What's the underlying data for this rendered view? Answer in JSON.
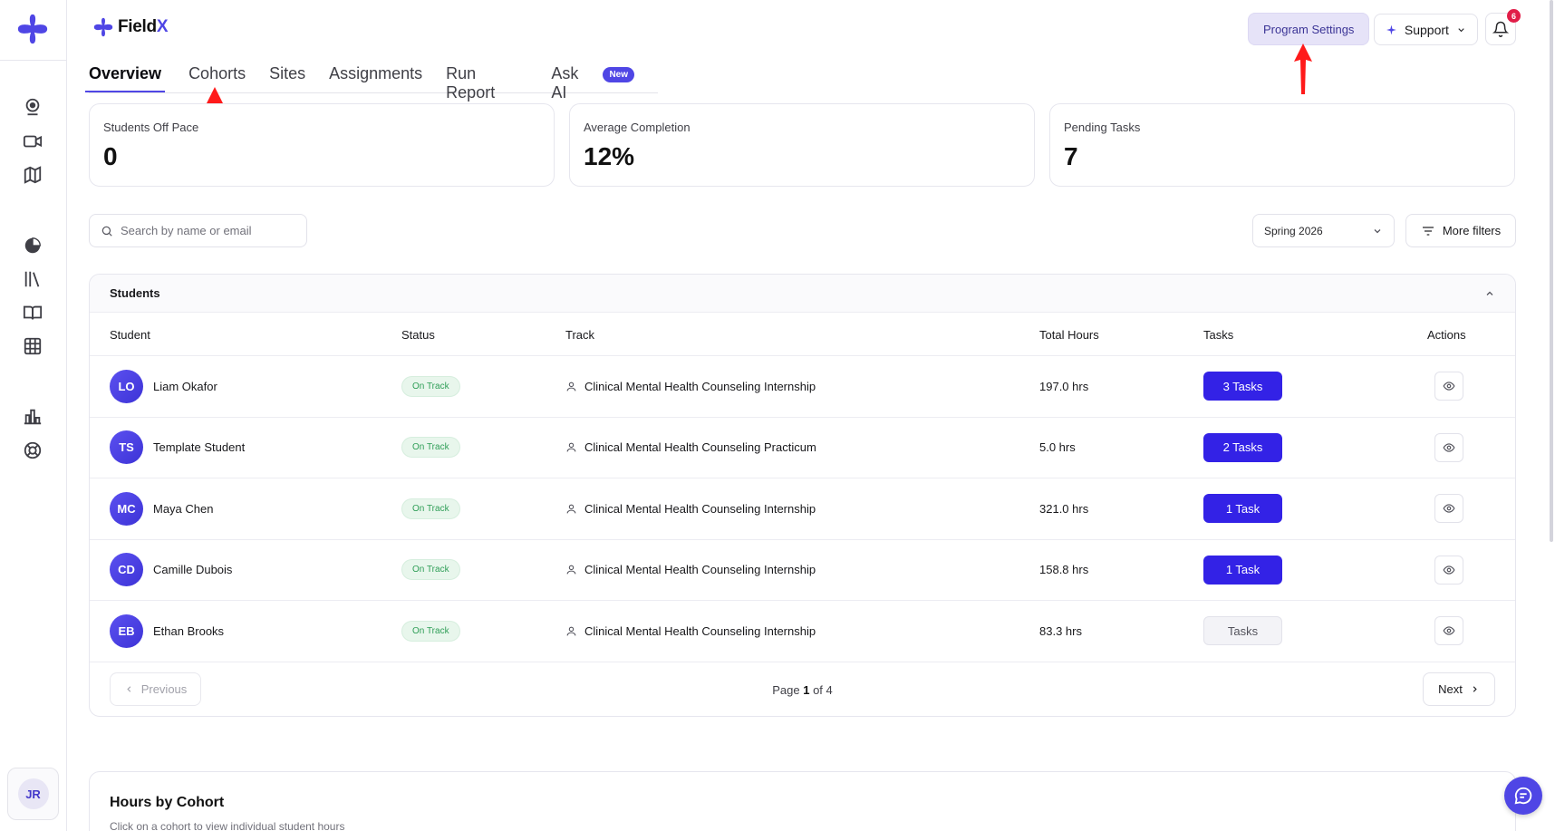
{
  "brand": {
    "name_prefix": "Field",
    "name_suffix": "X"
  },
  "header": {
    "program_settings_label": "Program Settings",
    "support_label": "Support",
    "notification_count": "6"
  },
  "tabs": [
    {
      "label": "Overview",
      "active": true
    },
    {
      "label": "Cohorts"
    },
    {
      "label": "Sites"
    },
    {
      "label": "Assignments"
    },
    {
      "label": "Run Report"
    },
    {
      "label": "Ask AI",
      "badge": "New"
    }
  ],
  "stats": [
    {
      "label": "Students Off Pace",
      "value": "0"
    },
    {
      "label": "Average Completion",
      "value": "12%"
    },
    {
      "label": "Pending Tasks",
      "value": "7"
    }
  ],
  "search": {
    "placeholder": "Search by name or email"
  },
  "filters": {
    "term": "Spring 2026",
    "more_label": "More filters"
  },
  "students_panel": {
    "title": "Students",
    "columns": [
      "Student",
      "Status",
      "Track",
      "Total Hours",
      "Tasks",
      "Actions"
    ],
    "rows": [
      {
        "initials": "LO",
        "name": "Liam Okafor",
        "status": "On Track",
        "track": "Clinical Mental Health Counseling Internship",
        "hours": "197.0 hrs",
        "tasks": "3 Tasks",
        "tasks_active": true
      },
      {
        "initials": "TS",
        "name": "Template Student",
        "status": "On Track",
        "track": "Clinical Mental Health Counseling Practicum",
        "hours": "5.0 hrs",
        "tasks": "2 Tasks",
        "tasks_active": true
      },
      {
        "initials": "MC",
        "name": "Maya Chen",
        "status": "On Track",
        "track": "Clinical Mental Health Counseling Internship",
        "hours": "321.0 hrs",
        "tasks": "1 Task",
        "tasks_active": true
      },
      {
        "initials": "CD",
        "name": "Camille Dubois",
        "status": "On Track",
        "track": "Clinical Mental Health Counseling Internship",
        "hours": "158.8 hrs",
        "tasks": "1 Task",
        "tasks_active": true
      },
      {
        "initials": "EB",
        "name": "Ethan Brooks",
        "status": "On Track",
        "track": "Clinical Mental Health Counseling Internship",
        "hours": "83.3 hrs",
        "tasks": "Tasks",
        "tasks_active": false
      }
    ],
    "pagination": {
      "prev_label": "Previous",
      "next_label": "Next",
      "page_prefix": "Page",
      "current": "1",
      "of_label": "of",
      "total": "4"
    }
  },
  "hours_panel": {
    "title": "Hours by Cohort",
    "subtitle": "Click on a cohort to view individual student hours"
  },
  "user": {
    "initials": "JR"
  },
  "colors": {
    "accent": "#4f46e5",
    "tasks_button": "#3322e6",
    "status_green": "#2f9e57",
    "annotation_arrow": "#ff1a1a"
  },
  "icons": [
    "app-logo-icon",
    "webcam-icon",
    "video-icon",
    "map-icon",
    "pie-chart-icon",
    "library-icon",
    "book-icon",
    "grid-icon",
    "bar-chart-icon",
    "lifebuoy-icon",
    "search-icon",
    "chevron-down-icon",
    "filter-icon",
    "chevron-up-icon",
    "user-icon",
    "eye-icon",
    "chevron-left-icon",
    "chevron-right-icon",
    "bell-icon",
    "sparkle-icon",
    "chat-icon"
  ]
}
